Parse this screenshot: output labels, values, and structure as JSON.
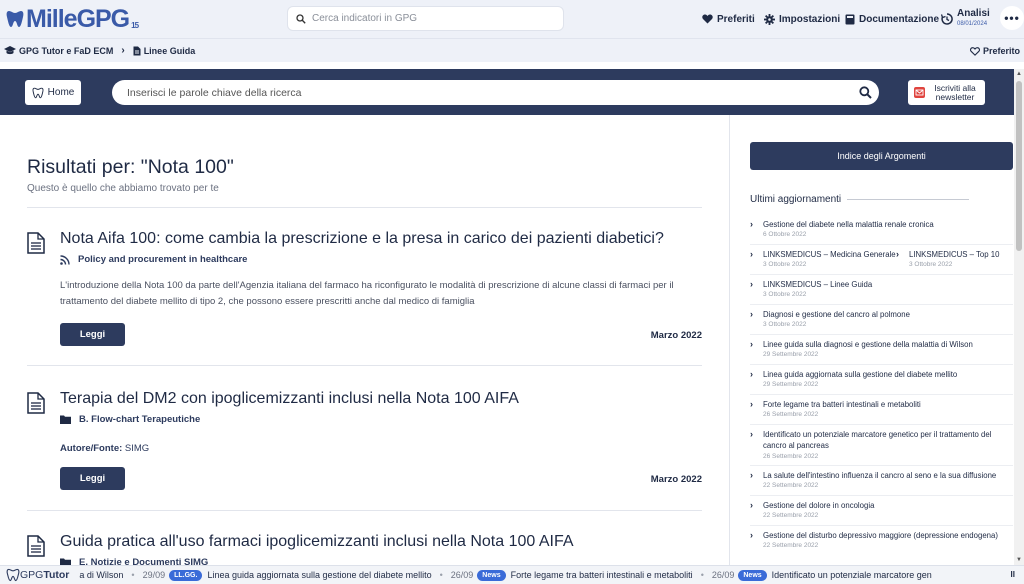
{
  "topbar": {
    "logo_text": "MilleGPG",
    "logo_sup": "15",
    "search_placeholder": "Cerca indicatori in GPG",
    "nav_preferiti": "Preferiti",
    "nav_impostazioni": "Impostazioni",
    "nav_documentazione": "Documentazione",
    "nav_analisi": "Analisi",
    "nav_analisi_date": "08/01/2024",
    "more": "•••"
  },
  "breadcrumb": {
    "item1": "GPG Tutor e FaD ECM",
    "item2": "Linee Guida",
    "preferito": "Preferito"
  },
  "header": {
    "home": "Home",
    "search_placeholder": "Inserisci le parole chiave della ricerca",
    "newsletter_line1": "Iscriviti alla",
    "newsletter_line2": "newsletter"
  },
  "results": {
    "title": "Risultati per: \"Nota 100\"",
    "subtitle": "Questo è quello che abbiamo trovato per te",
    "items": [
      {
        "title": "Nota Aifa 100: come cambia la prescrizione e la presa in carico dei pazienti diabetici?",
        "category": "Policy and procurement in healthcare",
        "excerpt": "L'introduzione della Nota 100 da parte dell'Agenzia italiana del farmaco ha riconfigurato le modalità di prescrizione di alcune classi di farmaci per il trattamento del diabete mellito di tipo 2, che possono essere prescritti anche dal medico di famiglia",
        "button": "Leggi",
        "date": "Marzo 2022"
      },
      {
        "title": "Terapia del DM2 con ipoglicemizzanti inclusi nella Nota 100 AIFA",
        "category": "B. Flow-chart Terapeutiche",
        "author_label": "Autore/Fonte:",
        "author_value": "SIMG",
        "button": "Leggi",
        "date": "Marzo 2022"
      },
      {
        "title": "Guida pratica all'uso farmaci ipoglicemizzanti inclusi nella Nota 100 AIFA",
        "category": "E. Notizie e Documenti SIMG"
      }
    ]
  },
  "sidebar": {
    "indice_button": "Indice degli Argomenti",
    "ultimi_title": "Ultimi aggiornamenti",
    "updates": [
      {
        "title": "Gestione del diabete nella malattia renale cronica",
        "date": "6 Ottobre 2022"
      },
      {
        "title": "LINKSMEDICUS – Medicina Generale",
        "date": "3 Ottobre 2022",
        "title2": "LINKSMEDICUS – Top 10",
        "date2": "3 Ottobre 2022"
      },
      {
        "title": "LINKSMEDICUS – Linee Guida",
        "date": "3 Ottobre 2022"
      },
      {
        "title": "Diagnosi e gestione del cancro al polmone",
        "date": "3 Ottobre 2022"
      },
      {
        "title": "Linee guida sulla diagnosi e gestione della malattia di Wilson",
        "date": "29 Settembre 2022"
      },
      {
        "title": "Linea guida aggiornata sulla gestione del diabete mellito",
        "date": "29 Settembre 2022"
      },
      {
        "title": "Forte legame tra batteri intestinali e metaboliti",
        "date": "26 Settembre 2022"
      },
      {
        "title": "Identificato un potenziale marcatore genetico per il trattamento del cancro al pancreas",
        "date": "26 Settembre 2022"
      },
      {
        "title": "La salute dell'intestino influenza il cancro al seno e la sua diffusione",
        "date": "22 Settembre 2022"
      },
      {
        "title": "Gestione del dolore in oncologia",
        "date": "22 Settembre 2022"
      },
      {
        "title": "Gestione del disturbo depressivo maggiore (depressione endogena)",
        "date": "22 Settembre 2022"
      }
    ]
  },
  "ticker": {
    "brand_a": "GPG",
    "brand_b": "Tutor",
    "lead": "a di Wilson",
    "items": [
      {
        "date": "29/09",
        "badge": "LL.GG.",
        "text": "Linea guida aggiornata sulla gestione del diabete mellito"
      },
      {
        "date": "26/09",
        "badge": "News",
        "text": "Forte legame tra batteri intestinali e metaboliti"
      },
      {
        "date": "26/09",
        "badge": "News",
        "text": "Identificato un potenziale marcatore gen"
      }
    ],
    "pause": "II"
  },
  "colors": {
    "navy": "#2d3b5e",
    "accent_blue": "#3a6bd8",
    "bar_bg": "#eef1f8"
  }
}
